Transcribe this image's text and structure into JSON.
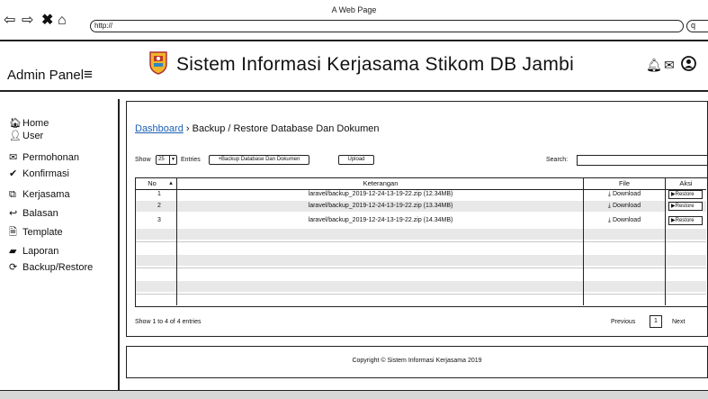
{
  "browser": {
    "window_title": "A Web Page",
    "url": "http://",
    "search_icon": "q"
  },
  "header": {
    "admin_title": "Admin Panel",
    "menu_icon": "≡",
    "app_title": "Sistem Informasi Kerjasama Stikom DB Jambi",
    "icons": [
      "bell-icon",
      "envelope-icon",
      "user-circle-icon"
    ]
  },
  "sidebar": {
    "items": [
      {
        "icon": "home-icon",
        "label": "Home"
      },
      {
        "icon": "user-icon",
        "label": "User"
      },
      {
        "icon": "envelope-icon",
        "label": "Permohonan"
      },
      {
        "icon": "check-icon",
        "label": "Konfirmasi"
      },
      {
        "icon": "external-link-icon",
        "label": "Kerjasama"
      },
      {
        "icon": "reply-icon",
        "label": "Balasan"
      },
      {
        "icon": "word-file-icon",
        "label": "Template"
      },
      {
        "icon": "book-icon",
        "label": "Laporan"
      },
      {
        "icon": "refresh-icon",
        "label": "Backup/Restore"
      }
    ]
  },
  "breadcrumb": {
    "link": "Dashboard",
    "separator": "›",
    "current": "Backup / Restore Database Dan Dokumen"
  },
  "controls": {
    "show_label": "Show",
    "entries_value": "25",
    "entries_label": "Entries",
    "backup_button": "+Backup Database Dan Dokumen",
    "upload_button": "Upload",
    "search_label": "Search:",
    "search_value": ""
  },
  "table": {
    "columns": [
      "No",
      "Keterangan",
      "File",
      "Aksi"
    ],
    "rows": [
      {
        "no": "1",
        "keterangan": "laravel/backup_2019-12-24-13-19-22.zip (12.34MB)",
        "file": "Download",
        "aksi": "Restore"
      },
      {
        "no": "2",
        "keterangan": "laravel/backup_2019-12-24-13-19-22.zip (13.34MB)",
        "file": "Download",
        "aksi": "Restore"
      },
      {
        "no": "3",
        "keterangan": "laravel/backup_2019-12-24-13-19-22.zip (14.34MB)",
        "file": "Download",
        "aksi": "Restore"
      }
    ]
  },
  "pagination": {
    "info": "Show 1 to 4 of 4 entries",
    "previous": "Previous",
    "page": "1",
    "next": "Next"
  },
  "footer": {
    "copyright": "Copyright © Sistem Informasi Kerjasama 2019"
  }
}
